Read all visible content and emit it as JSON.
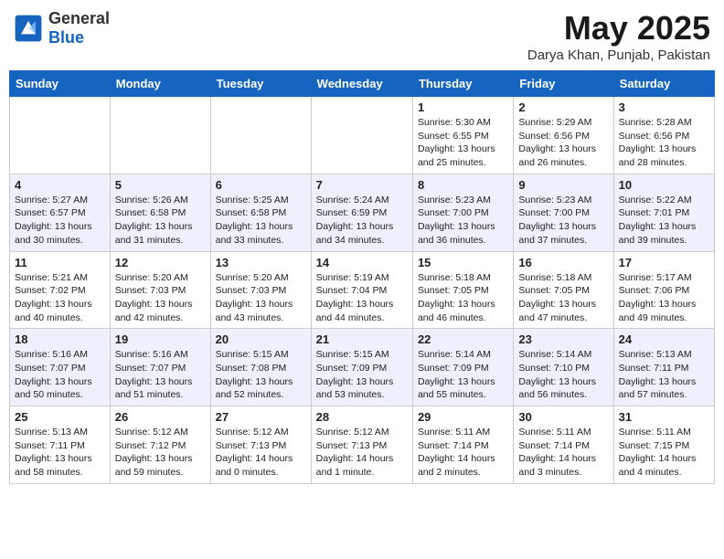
{
  "header": {
    "logo": {
      "line1": "General",
      "line2": "Blue"
    },
    "month": "May 2025",
    "location": "Darya Khan, Punjab, Pakistan"
  },
  "weekdays": [
    "Sunday",
    "Monday",
    "Tuesday",
    "Wednesday",
    "Thursday",
    "Friday",
    "Saturday"
  ],
  "weeks": [
    [
      {
        "day": "",
        "info": ""
      },
      {
        "day": "",
        "info": ""
      },
      {
        "day": "",
        "info": ""
      },
      {
        "day": "",
        "info": ""
      },
      {
        "day": "1",
        "info": "Sunrise: 5:30 AM\nSunset: 6:55 PM\nDaylight: 13 hours\nand 25 minutes."
      },
      {
        "day": "2",
        "info": "Sunrise: 5:29 AM\nSunset: 6:56 PM\nDaylight: 13 hours\nand 26 minutes."
      },
      {
        "day": "3",
        "info": "Sunrise: 5:28 AM\nSunset: 6:56 PM\nDaylight: 13 hours\nand 28 minutes."
      }
    ],
    [
      {
        "day": "4",
        "info": "Sunrise: 5:27 AM\nSunset: 6:57 PM\nDaylight: 13 hours\nand 30 minutes."
      },
      {
        "day": "5",
        "info": "Sunrise: 5:26 AM\nSunset: 6:58 PM\nDaylight: 13 hours\nand 31 minutes."
      },
      {
        "day": "6",
        "info": "Sunrise: 5:25 AM\nSunset: 6:58 PM\nDaylight: 13 hours\nand 33 minutes."
      },
      {
        "day": "7",
        "info": "Sunrise: 5:24 AM\nSunset: 6:59 PM\nDaylight: 13 hours\nand 34 minutes."
      },
      {
        "day": "8",
        "info": "Sunrise: 5:23 AM\nSunset: 7:00 PM\nDaylight: 13 hours\nand 36 minutes."
      },
      {
        "day": "9",
        "info": "Sunrise: 5:23 AM\nSunset: 7:00 PM\nDaylight: 13 hours\nand 37 minutes."
      },
      {
        "day": "10",
        "info": "Sunrise: 5:22 AM\nSunset: 7:01 PM\nDaylight: 13 hours\nand 39 minutes."
      }
    ],
    [
      {
        "day": "11",
        "info": "Sunrise: 5:21 AM\nSunset: 7:02 PM\nDaylight: 13 hours\nand 40 minutes."
      },
      {
        "day": "12",
        "info": "Sunrise: 5:20 AM\nSunset: 7:03 PM\nDaylight: 13 hours\nand 42 minutes."
      },
      {
        "day": "13",
        "info": "Sunrise: 5:20 AM\nSunset: 7:03 PM\nDaylight: 13 hours\nand 43 minutes."
      },
      {
        "day": "14",
        "info": "Sunrise: 5:19 AM\nSunset: 7:04 PM\nDaylight: 13 hours\nand 44 minutes."
      },
      {
        "day": "15",
        "info": "Sunrise: 5:18 AM\nSunset: 7:05 PM\nDaylight: 13 hours\nand 46 minutes."
      },
      {
        "day": "16",
        "info": "Sunrise: 5:18 AM\nSunset: 7:05 PM\nDaylight: 13 hours\nand 47 minutes."
      },
      {
        "day": "17",
        "info": "Sunrise: 5:17 AM\nSunset: 7:06 PM\nDaylight: 13 hours\nand 49 minutes."
      }
    ],
    [
      {
        "day": "18",
        "info": "Sunrise: 5:16 AM\nSunset: 7:07 PM\nDaylight: 13 hours\nand 50 minutes."
      },
      {
        "day": "19",
        "info": "Sunrise: 5:16 AM\nSunset: 7:07 PM\nDaylight: 13 hours\nand 51 minutes."
      },
      {
        "day": "20",
        "info": "Sunrise: 5:15 AM\nSunset: 7:08 PM\nDaylight: 13 hours\nand 52 minutes."
      },
      {
        "day": "21",
        "info": "Sunrise: 5:15 AM\nSunset: 7:09 PM\nDaylight: 13 hours\nand 53 minutes."
      },
      {
        "day": "22",
        "info": "Sunrise: 5:14 AM\nSunset: 7:09 PM\nDaylight: 13 hours\nand 55 minutes."
      },
      {
        "day": "23",
        "info": "Sunrise: 5:14 AM\nSunset: 7:10 PM\nDaylight: 13 hours\nand 56 minutes."
      },
      {
        "day": "24",
        "info": "Sunrise: 5:13 AM\nSunset: 7:11 PM\nDaylight: 13 hours\nand 57 minutes."
      }
    ],
    [
      {
        "day": "25",
        "info": "Sunrise: 5:13 AM\nSunset: 7:11 PM\nDaylight: 13 hours\nand 58 minutes."
      },
      {
        "day": "26",
        "info": "Sunrise: 5:12 AM\nSunset: 7:12 PM\nDaylight: 13 hours\nand 59 minutes."
      },
      {
        "day": "27",
        "info": "Sunrise: 5:12 AM\nSunset: 7:13 PM\nDaylight: 14 hours\nand 0 minutes."
      },
      {
        "day": "28",
        "info": "Sunrise: 5:12 AM\nSunset: 7:13 PM\nDaylight: 14 hours\nand 1 minute."
      },
      {
        "day": "29",
        "info": "Sunrise: 5:11 AM\nSunset: 7:14 PM\nDaylight: 14 hours\nand 2 minutes."
      },
      {
        "day": "30",
        "info": "Sunrise: 5:11 AM\nSunset: 7:14 PM\nDaylight: 14 hours\nand 3 minutes."
      },
      {
        "day": "31",
        "info": "Sunrise: 5:11 AM\nSunset: 7:15 PM\nDaylight: 14 hours\nand 4 minutes."
      }
    ]
  ]
}
